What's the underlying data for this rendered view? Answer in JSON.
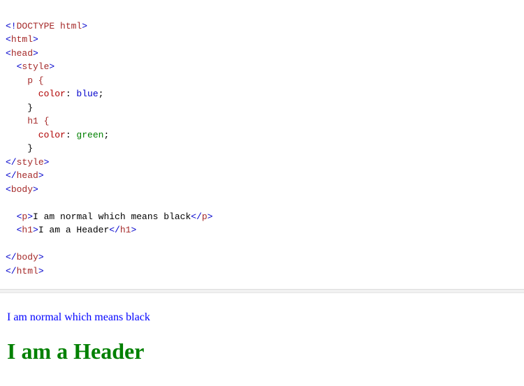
{
  "code": {
    "line1_doctype": "DOCTYPE html",
    "line2_html": "html",
    "line3_head": "head",
    "line4_style": "style",
    "line5_sel": "p {",
    "line6_prop": "color",
    "line6_val": "blue",
    "line7_close": "}",
    "line8_sel": "h1 {",
    "line9_prop": "color",
    "line9_val": "green",
    "line10_close": "}",
    "line11_style_close": "style",
    "line12_head_close": "head",
    "line13_body": "body",
    "line14_tag": "p",
    "line14_text": "I am normal which means black",
    "line15_tag": "h1",
    "line15_text": "I am a Header",
    "line16_body_close": "body",
    "line17_html_close": "html"
  },
  "render": {
    "p_text": "I am normal which means black",
    "h1_text": "I am a Header"
  }
}
